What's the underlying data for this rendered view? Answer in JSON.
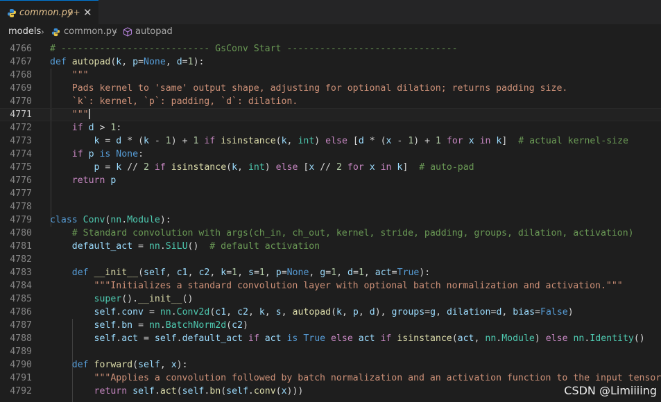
{
  "tab": {
    "filename": "common.py",
    "badge": "9+",
    "close": "✕"
  },
  "breadcrumb": [
    "models",
    "common.py",
    "autopad"
  ],
  "watermark": "CSDN @Limiiiing",
  "colors": {
    "keyword": "#569cd6",
    "control": "#c586c0",
    "function": "#dcdcaa",
    "class": "#4ec9b0",
    "string": "#ce9178",
    "comment": "#6a9955",
    "number": "#b5cea8",
    "variable": "#9cdcfe",
    "text": "#d4d4d4",
    "modified_tab": "#e2c08d"
  },
  "current_line": "4771",
  "lines": [
    {
      "n": "4766",
      "t": [
        [
          "com",
          "# --------------------------- GsConv Start -------------------------------"
        ]
      ]
    },
    {
      "n": "4767",
      "t": [
        [
          "kw",
          "def "
        ],
        [
          "fn",
          "autopad"
        ],
        [
          "",
          "("
        ],
        [
          "var",
          "k"
        ],
        [
          "",
          ", "
        ],
        [
          "var",
          "p"
        ],
        [
          "",
          "="
        ],
        [
          "kw",
          "None"
        ],
        [
          "",
          ", "
        ],
        [
          "var",
          "d"
        ],
        [
          "",
          "="
        ],
        [
          "num",
          "1"
        ],
        [
          "",
          "):"
        ]
      ]
    },
    {
      "n": "4768",
      "t": [
        [
          "str",
          "    \"\"\""
        ]
      ]
    },
    {
      "n": "4769",
      "t": [
        [
          "str",
          "    Pads kernel to 'same' output shape, adjusting for optional dilation; returns padding size."
        ]
      ]
    },
    {
      "n": "4770",
      "t": [
        [
          "str",
          "    `k`: kernel, `p`: padding, `d`: dilation."
        ]
      ]
    },
    {
      "n": "4771",
      "t": [
        [
          "str",
          "    \"\"\""
        ]
      ]
    },
    {
      "n": "4772",
      "t": [
        [
          "ctl",
          "    if "
        ],
        [
          "var",
          "d"
        ],
        [
          "",
          " > "
        ],
        [
          "num",
          "1"
        ],
        [
          "",
          ":"
        ]
      ]
    },
    {
      "n": "4773",
      "t": [
        [
          "var",
          "        k"
        ],
        [
          "",
          " = "
        ],
        [
          "var",
          "d"
        ],
        [
          "",
          " * ("
        ],
        [
          "var",
          "k"
        ],
        [
          "",
          " - "
        ],
        [
          "num",
          "1"
        ],
        [
          "",
          ") + "
        ],
        [
          "num",
          "1"
        ],
        [
          "ctl",
          " if "
        ],
        [
          "fn",
          "isinstance"
        ],
        [
          "",
          "("
        ],
        [
          "var",
          "k"
        ],
        [
          "",
          ", "
        ],
        [
          "cls",
          "int"
        ],
        [
          "",
          ")"
        ],
        [
          "ctl",
          " else "
        ],
        [
          "",
          "["
        ],
        [
          "var",
          "d"
        ],
        [
          "",
          " * ("
        ],
        [
          "var",
          "x"
        ],
        [
          "",
          " - "
        ],
        [
          "num",
          "1"
        ],
        [
          "",
          ") + "
        ],
        [
          "num",
          "1"
        ],
        [
          "ctl",
          " for "
        ],
        [
          "var",
          "x"
        ],
        [
          "ctl",
          " in "
        ],
        [
          "var",
          "k"
        ],
        [
          "",
          "]  "
        ],
        [
          "com",
          "# actual kernel-size"
        ]
      ]
    },
    {
      "n": "4774",
      "t": [
        [
          "ctl",
          "    if "
        ],
        [
          "var",
          "p"
        ],
        [
          "kw",
          " is "
        ],
        [
          "kw",
          "None"
        ],
        [
          "",
          ":"
        ]
      ]
    },
    {
      "n": "4775",
      "t": [
        [
          "var",
          "        p"
        ],
        [
          "",
          " = "
        ],
        [
          "var",
          "k"
        ],
        [
          "",
          " // "
        ],
        [
          "num",
          "2"
        ],
        [
          "ctl",
          " if "
        ],
        [
          "fn",
          "isinstance"
        ],
        [
          "",
          "("
        ],
        [
          "var",
          "k"
        ],
        [
          "",
          ", "
        ],
        [
          "cls",
          "int"
        ],
        [
          "",
          ")"
        ],
        [
          "ctl",
          " else "
        ],
        [
          "",
          "["
        ],
        [
          "var",
          "x"
        ],
        [
          "",
          " // "
        ],
        [
          "num",
          "2"
        ],
        [
          "ctl",
          " for "
        ],
        [
          "var",
          "x"
        ],
        [
          "ctl",
          " in "
        ],
        [
          "var",
          "k"
        ],
        [
          "",
          "]  "
        ],
        [
          "com",
          "# auto-pad"
        ]
      ]
    },
    {
      "n": "4776",
      "t": [
        [
          "ctl",
          "    return "
        ],
        [
          "var",
          "p"
        ]
      ]
    },
    {
      "n": "4777",
      "t": []
    },
    {
      "n": "4778",
      "t": []
    },
    {
      "n": "4779",
      "t": [
        [
          "kw",
          "class "
        ],
        [
          "cls",
          "Conv"
        ],
        [
          "",
          "("
        ],
        [
          "cls",
          "nn"
        ],
        [
          "",
          "."
        ],
        [
          "cls",
          "Module"
        ],
        [
          "",
          "):"
        ]
      ]
    },
    {
      "n": "4780",
      "t": [
        [
          "com",
          "    # Standard convolution with args(ch_in, ch_out, kernel, stride, padding, groups, dilation, activation)"
        ]
      ]
    },
    {
      "n": "4781",
      "t": [
        [
          "var",
          "    default_act"
        ],
        [
          "",
          " = "
        ],
        [
          "cls",
          "nn"
        ],
        [
          "",
          "."
        ],
        [
          "cls",
          "SiLU"
        ],
        [
          "",
          "()  "
        ],
        [
          "com",
          "# default activation"
        ]
      ]
    },
    {
      "n": "4782",
      "t": []
    },
    {
      "n": "4783",
      "t": [
        [
          "kw",
          "    def "
        ],
        [
          "fn",
          "__init__"
        ],
        [
          "",
          "("
        ],
        [
          "var",
          "self"
        ],
        [
          "",
          ", "
        ],
        [
          "var",
          "c1"
        ],
        [
          "",
          ", "
        ],
        [
          "var",
          "c2"
        ],
        [
          "",
          ", "
        ],
        [
          "var",
          "k"
        ],
        [
          "",
          "="
        ],
        [
          "num",
          "1"
        ],
        [
          "",
          ", "
        ],
        [
          "var",
          "s"
        ],
        [
          "",
          "="
        ],
        [
          "num",
          "1"
        ],
        [
          "",
          ", "
        ],
        [
          "var",
          "p"
        ],
        [
          "",
          "="
        ],
        [
          "kw",
          "None"
        ],
        [
          "",
          ", "
        ],
        [
          "var",
          "g"
        ],
        [
          "",
          "="
        ],
        [
          "num",
          "1"
        ],
        [
          "",
          ", "
        ],
        [
          "var",
          "d"
        ],
        [
          "",
          "="
        ],
        [
          "num",
          "1"
        ],
        [
          "",
          ", "
        ],
        [
          "var",
          "act"
        ],
        [
          "",
          "="
        ],
        [
          "kw",
          "True"
        ],
        [
          "",
          "):"
        ]
      ]
    },
    {
      "n": "4784",
      "t": [
        [
          "str",
          "        \"\"\"Initializes a standard convolution layer with optional batch normalization and activation.\"\"\""
        ]
      ]
    },
    {
      "n": "4785",
      "t": [
        [
          "cls",
          "        super"
        ],
        [
          "",
          "()."
        ],
        [
          "fn",
          "__init__"
        ],
        [
          "",
          "()"
        ]
      ]
    },
    {
      "n": "4786",
      "t": [
        [
          "var",
          "        self"
        ],
        [
          "",
          "."
        ],
        [
          "var",
          "conv"
        ],
        [
          "",
          " = "
        ],
        [
          "cls",
          "nn"
        ],
        [
          "",
          "."
        ],
        [
          "cls",
          "Conv2d"
        ],
        [
          "",
          "("
        ],
        [
          "var",
          "c1"
        ],
        [
          "",
          ", "
        ],
        [
          "var",
          "c2"
        ],
        [
          "",
          ", "
        ],
        [
          "var",
          "k"
        ],
        [
          "",
          ", "
        ],
        [
          "var",
          "s"
        ],
        [
          "",
          ", "
        ],
        [
          "fn",
          "autopad"
        ],
        [
          "",
          "("
        ],
        [
          "var",
          "k"
        ],
        [
          "",
          ", "
        ],
        [
          "var",
          "p"
        ],
        [
          "",
          ", "
        ],
        [
          "var",
          "d"
        ],
        [
          "",
          "), "
        ],
        [
          "var",
          "groups"
        ],
        [
          "",
          "="
        ],
        [
          "var",
          "g"
        ],
        [
          "",
          ", "
        ],
        [
          "var",
          "dilation"
        ],
        [
          "",
          "="
        ],
        [
          "var",
          "d"
        ],
        [
          "",
          ", "
        ],
        [
          "var",
          "bias"
        ],
        [
          "",
          "="
        ],
        [
          "kw",
          "False"
        ],
        [
          "",
          ")"
        ]
      ]
    },
    {
      "n": "4787",
      "t": [
        [
          "var",
          "        self"
        ],
        [
          "",
          "."
        ],
        [
          "var",
          "bn"
        ],
        [
          "",
          " = "
        ],
        [
          "cls",
          "nn"
        ],
        [
          "",
          "."
        ],
        [
          "cls",
          "BatchNorm2d"
        ],
        [
          "",
          "("
        ],
        [
          "var",
          "c2"
        ],
        [
          "",
          ")"
        ]
      ]
    },
    {
      "n": "4788",
      "t": [
        [
          "var",
          "        self"
        ],
        [
          "",
          "."
        ],
        [
          "var",
          "act"
        ],
        [
          "",
          " = "
        ],
        [
          "var",
          "self"
        ],
        [
          "",
          "."
        ],
        [
          "var",
          "default_act"
        ],
        [
          "ctl",
          " if "
        ],
        [
          "var",
          "act"
        ],
        [
          "kw",
          " is "
        ],
        [
          "kw",
          "True"
        ],
        [
          "ctl",
          " else "
        ],
        [
          "var",
          "act"
        ],
        [
          "ctl",
          " if "
        ],
        [
          "fn",
          "isinstance"
        ],
        [
          "",
          "("
        ],
        [
          "var",
          "act"
        ],
        [
          "",
          ", "
        ],
        [
          "cls",
          "nn"
        ],
        [
          "",
          "."
        ],
        [
          "cls",
          "Module"
        ],
        [
          "",
          ")"
        ],
        [
          "ctl",
          " else "
        ],
        [
          "cls",
          "nn"
        ],
        [
          "",
          "."
        ],
        [
          "cls",
          "Identity"
        ],
        [
          "",
          "()"
        ]
      ]
    },
    {
      "n": "4789",
      "t": []
    },
    {
      "n": "4790",
      "t": [
        [
          "kw",
          "    def "
        ],
        [
          "fn",
          "forward"
        ],
        [
          "",
          "("
        ],
        [
          "var",
          "self"
        ],
        [
          "",
          ", "
        ],
        [
          "var",
          "x"
        ],
        [
          "",
          "):"
        ]
      ]
    },
    {
      "n": "4791",
      "t": [
        [
          "str",
          "        \"\"\"Applies a convolution followed by batch normalization and an activation function to the input tensor `x`"
        ]
      ]
    },
    {
      "n": "4792",
      "t": [
        [
          "ctl",
          "        return "
        ],
        [
          "var",
          "self"
        ],
        [
          "",
          "."
        ],
        [
          "fn",
          "act"
        ],
        [
          "",
          "("
        ],
        [
          "var",
          "self"
        ],
        [
          "",
          "."
        ],
        [
          "fn",
          "bn"
        ],
        [
          "",
          "("
        ],
        [
          "var",
          "self"
        ],
        [
          "",
          "."
        ],
        [
          "fn",
          "conv"
        ],
        [
          "",
          "("
        ],
        [
          "var",
          "x"
        ],
        [
          "",
          ")))"
        ]
      ]
    }
  ]
}
